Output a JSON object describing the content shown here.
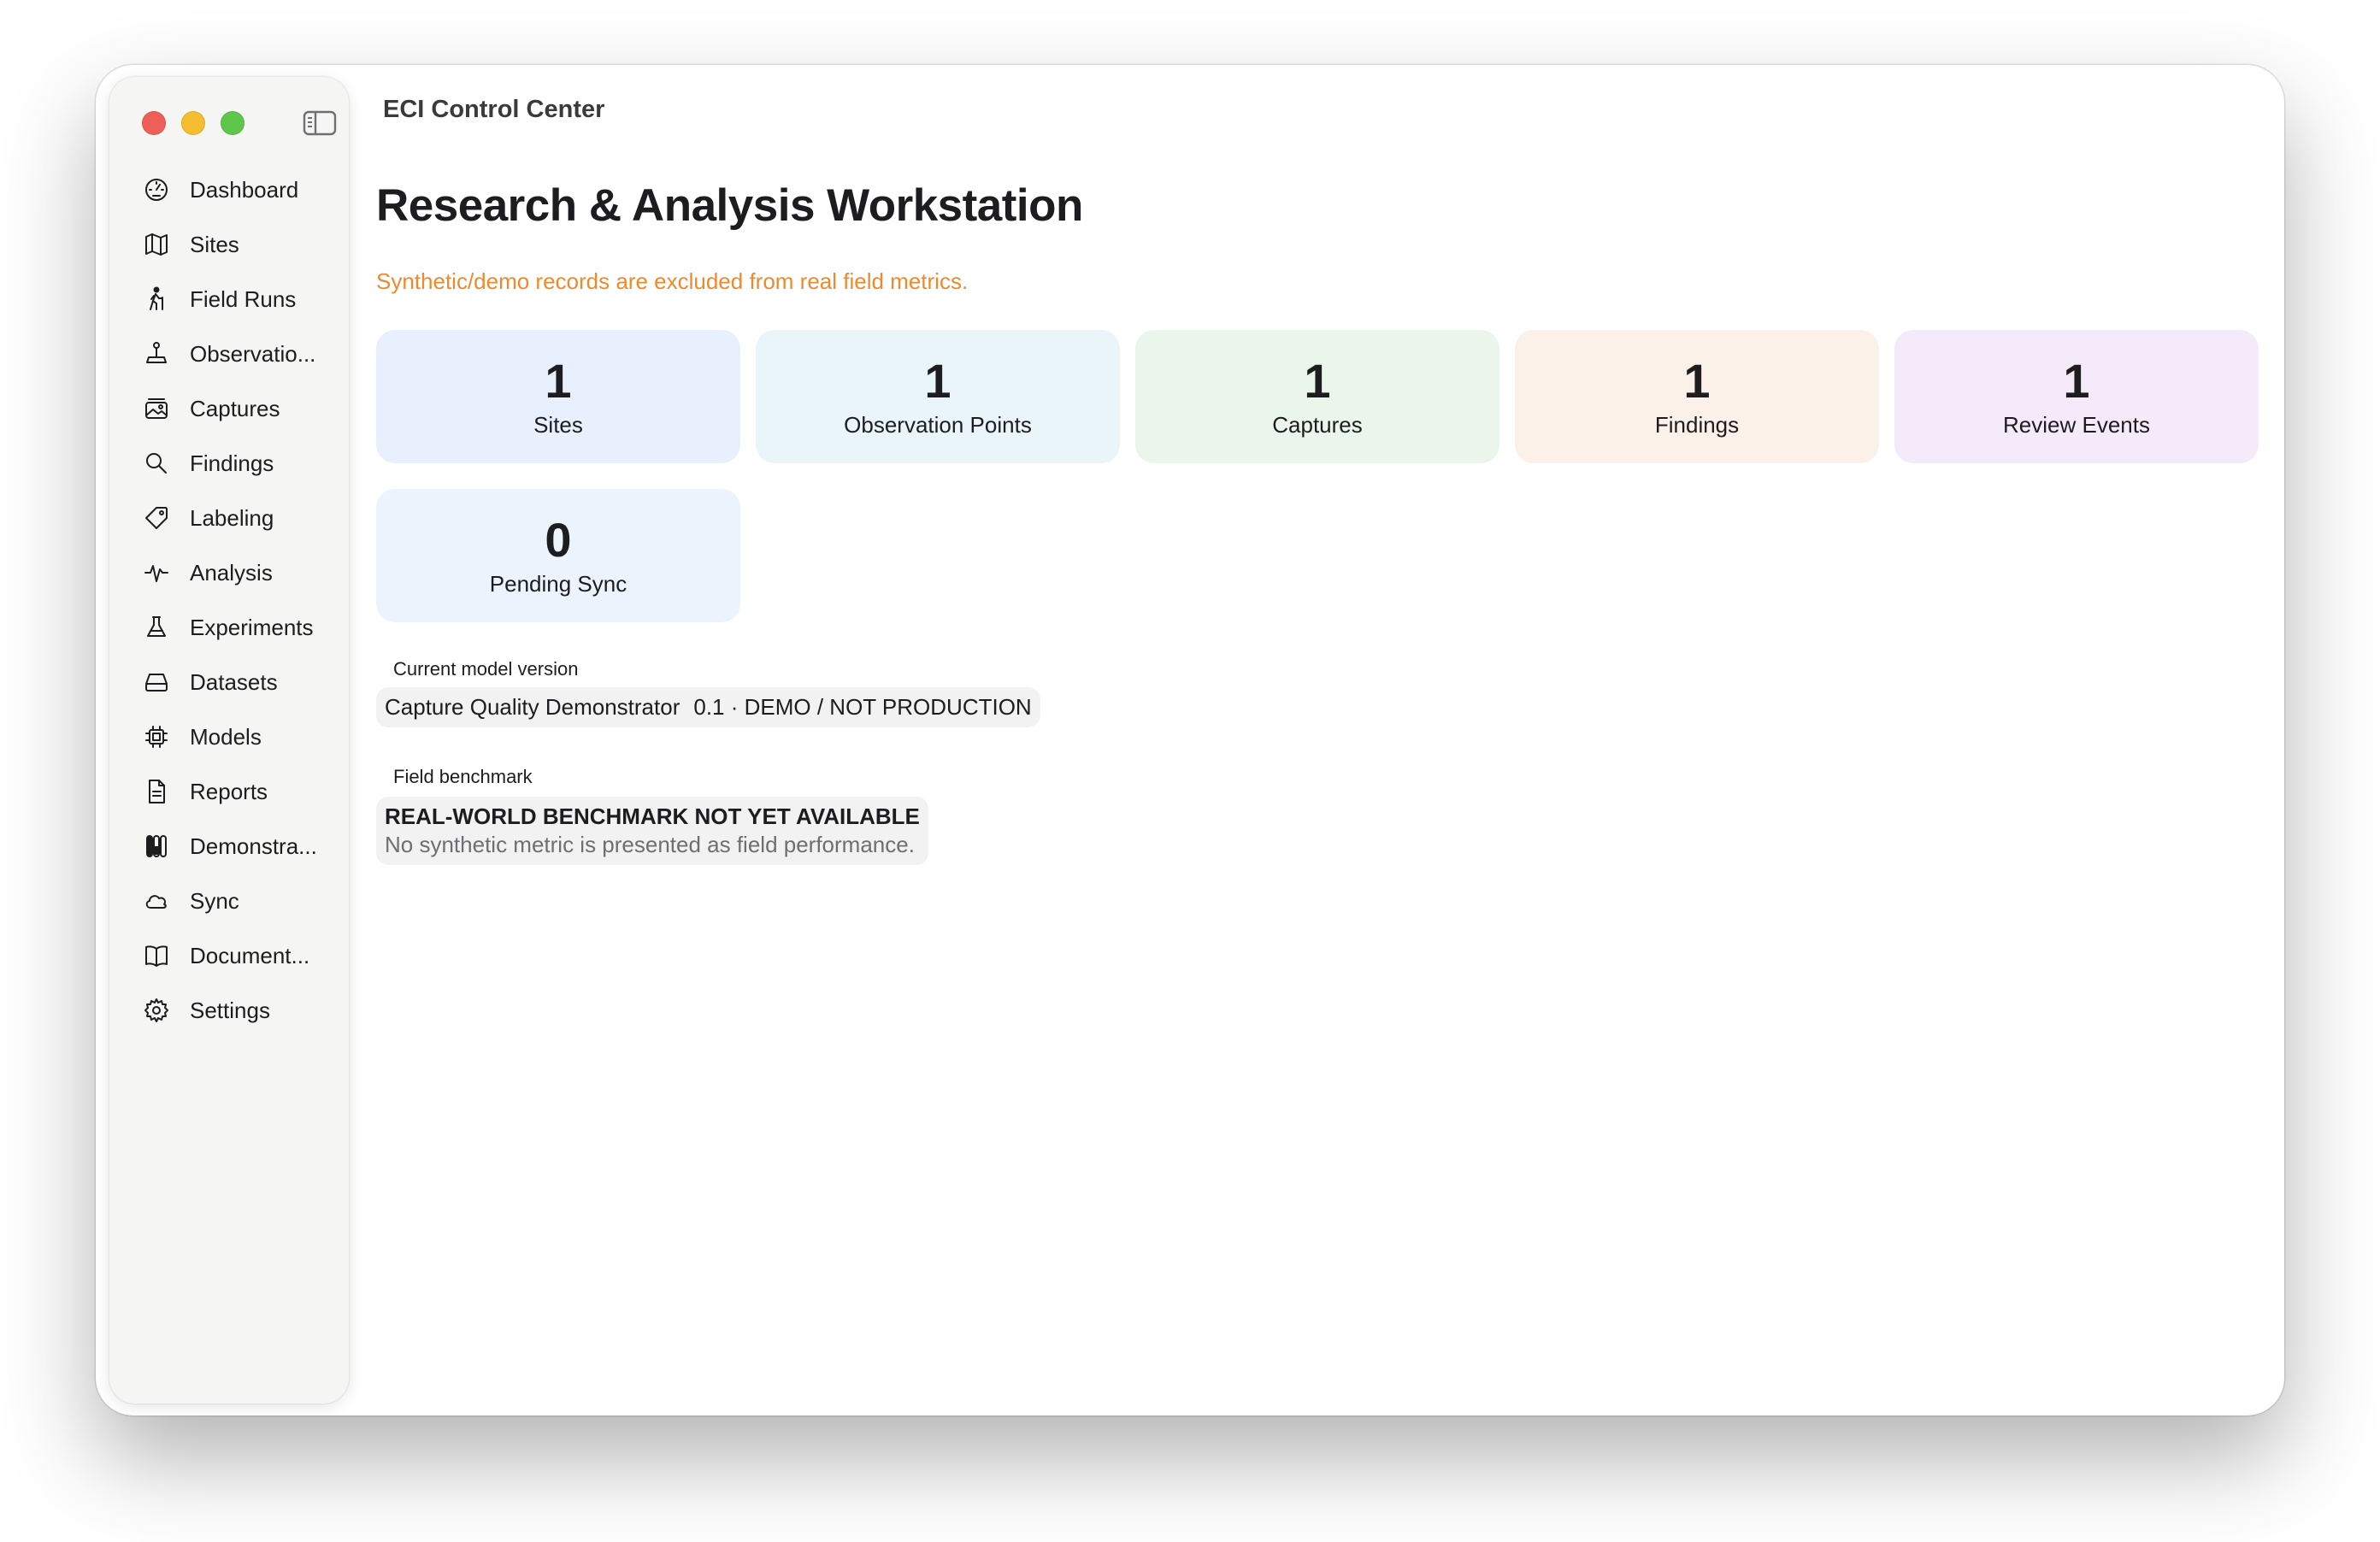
{
  "window": {
    "title": "ECI Control Center"
  },
  "sidebar": {
    "items": [
      {
        "label": "Dashboard",
        "icon": "dashboard-gauge-icon"
      },
      {
        "label": "Sites",
        "icon": "map-icon"
      },
      {
        "label": "Field Runs",
        "icon": "hiker-icon"
      },
      {
        "label": "Observatio...",
        "icon": "joystick-pin-icon"
      },
      {
        "label": "Captures",
        "icon": "photo-stack-icon"
      },
      {
        "label": "Findings",
        "icon": "magnifier-icon"
      },
      {
        "label": "Labeling",
        "icon": "tag-icon"
      },
      {
        "label": "Analysis",
        "icon": "waveform-icon"
      },
      {
        "label": "Experiments",
        "icon": "flask-icon"
      },
      {
        "label": "Datasets",
        "icon": "drive-icon"
      },
      {
        "label": "Models",
        "icon": "cpu-icon"
      },
      {
        "label": "Reports",
        "icon": "document-icon"
      },
      {
        "label": "Demonstra...",
        "icon": "test-tubes-icon"
      },
      {
        "label": "Sync",
        "icon": "cloud-icon"
      },
      {
        "label": "Document...",
        "icon": "book-icon"
      },
      {
        "label": "Settings",
        "icon": "gear-icon"
      }
    ]
  },
  "main": {
    "title": "Research & Analysis Workstation",
    "notice": "Synthetic/demo records are excluded from real field metrics.",
    "stats": [
      {
        "value": "1",
        "label": "Sites",
        "color": "#e8f0fd"
      },
      {
        "value": "1",
        "label": "Observation Points",
        "color": "#e9f5f8"
      },
      {
        "value": "1",
        "label": "Captures",
        "color": "#eaf6ec"
      },
      {
        "value": "1",
        "label": "Findings",
        "color": "#fbf1e8"
      },
      {
        "value": "1",
        "label": "Review Events",
        "color": "#f5eaf9"
      },
      {
        "value": "0",
        "label": "Pending Sync",
        "color": "#ebf4fd"
      }
    ],
    "model": {
      "heading": "Current model version",
      "name": "Capture Quality Demonstrator",
      "version": "0.1 · DEMO / NOT PRODUCTION"
    },
    "benchmark": {
      "heading": "Field benchmark",
      "status": "REAL-WORLD BENCHMARK NOT YET AVAILABLE",
      "note": "No synthetic metric is presented as field performance."
    }
  },
  "colors": {
    "accent_notice": "#ee8a2c",
    "close": "#ee5f57",
    "minimize": "#f5be30",
    "maximize": "#5ec64a"
  }
}
